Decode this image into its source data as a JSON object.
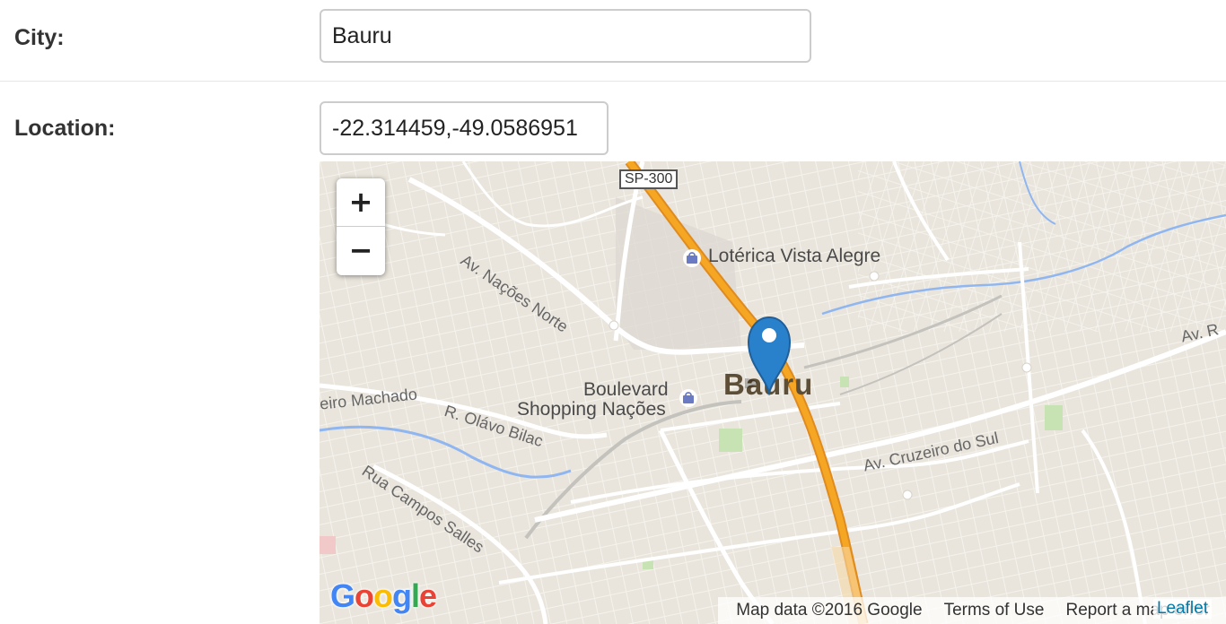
{
  "form": {
    "city": {
      "label": "City:",
      "value": "Bauru"
    },
    "location": {
      "label": "Location:",
      "value": "-22.314459,-49.0586951"
    }
  },
  "map": {
    "zoom_in": "+",
    "zoom_out": "−",
    "route_shield": "SP-300",
    "city_name": "Bauru",
    "pois": [
      {
        "name": "Lotérica Vista Alegre"
      },
      {
        "name_line1": "Boulevard",
        "name_line2": "Shopping Nações"
      }
    ],
    "roads": [
      "Av. Nações Norte",
      "eiro Machado",
      "R. Olávo Bilac",
      "Rua Campos Salles",
      "Av. Cruzeiro do Sul",
      "Av. R"
    ],
    "attribution": {
      "map_data": "Map data ©2016 Google",
      "terms": "Terms of Use",
      "report": "Report a map error",
      "leaflet": "Leaflet"
    },
    "google_logo": [
      "G",
      "o",
      "o",
      "g",
      "l",
      "e"
    ],
    "google_colors": [
      "#4285F4",
      "#EA4335",
      "#FBBC05",
      "#4285F4",
      "#34A853",
      "#EA4335"
    ],
    "marker_color": "#2a81cb",
    "highway_color": "#f5a623"
  }
}
